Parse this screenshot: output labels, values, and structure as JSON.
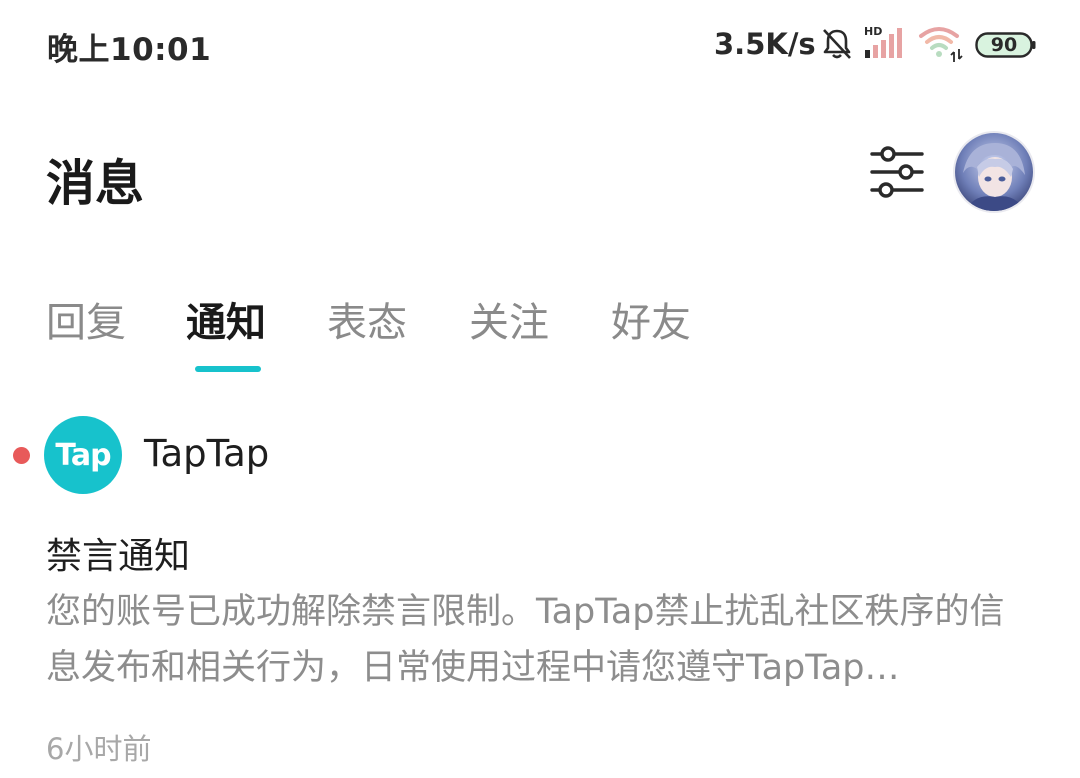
{
  "status_bar": {
    "time": "晚上10:01",
    "net_speed": "3.5K/s",
    "battery": "90",
    "hd": "HD"
  },
  "header": {
    "title": "消息"
  },
  "tabs": [
    {
      "label": "回复",
      "active": false
    },
    {
      "label": "通知",
      "active": true
    },
    {
      "label": "表态",
      "active": false
    },
    {
      "label": "关注",
      "active": false
    },
    {
      "label": "好友",
      "active": false
    }
  ],
  "notification": {
    "sender_logo": "Tap",
    "sender": "TapTap",
    "title": "禁言通知",
    "body": "您的账号已成功解除禁言限制。TapTap禁止扰乱社区秩序的信息发布和相关行为，日常使用过程中请您遵守TapTap…",
    "time": "6小时前",
    "unread": true
  },
  "colors": {
    "accent": "#17c2cc",
    "unread_dot": "#e85a5a",
    "text_primary": "#1e1e1e",
    "text_secondary": "#8d8d8d",
    "tab_inactive": "#8a8a8a",
    "background": "#ffffff"
  }
}
